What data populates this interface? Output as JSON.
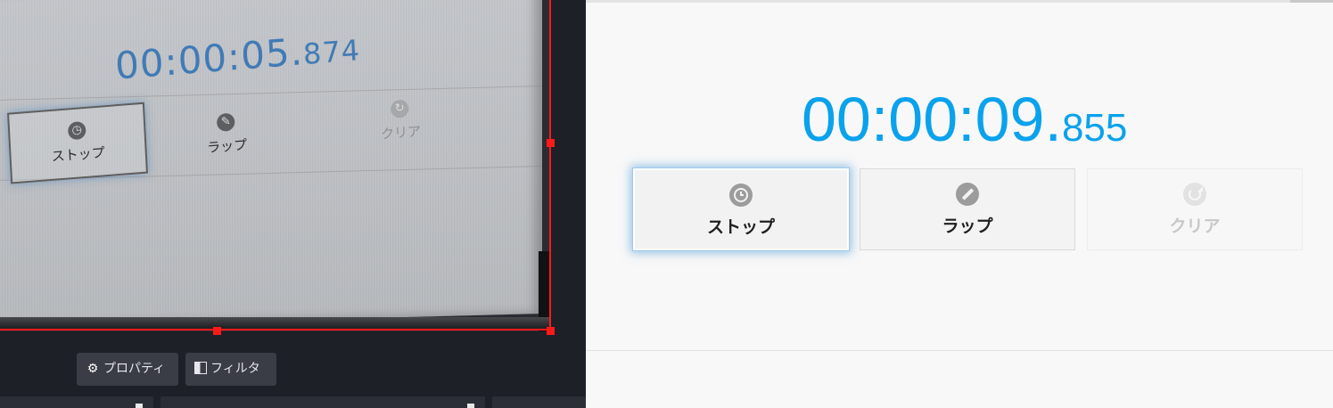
{
  "editor": {
    "preview": {
      "photo_timer": {
        "main": "00:00:05.",
        "ms": "874"
      },
      "photo_buttons": {
        "stop": "ストップ",
        "lap": "ラップ",
        "clear": "クリア"
      }
    },
    "toolbar": {
      "properties_label": "プロパティ",
      "filter_label": "フィルタ"
    },
    "selection_color": "#ff1a1a"
  },
  "stopwatch": {
    "time_main": "00:00:09.",
    "time_ms": "855",
    "accent_color": "#0aa2ec",
    "buttons": {
      "stop_label": "ストップ",
      "stop_icon": "clock-icon",
      "lap_label": "ラップ",
      "lap_icon": "pencil-icon",
      "clear_label": "クリア",
      "clear_icon": "refresh-icon"
    }
  }
}
